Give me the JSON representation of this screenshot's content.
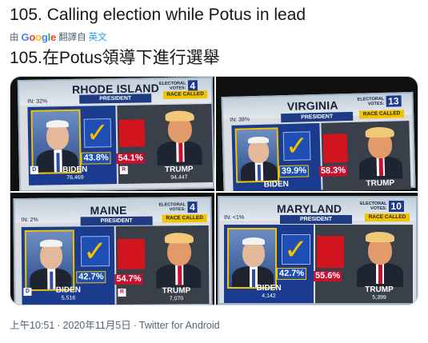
{
  "tweet": {
    "text": "105. Calling election while Potus in lead",
    "translate_prefix": "由",
    "translate_suffix": "翻譯自",
    "translate_lang": "英文",
    "translated_text": "105.在Potus領導下進行選舉",
    "meta": {
      "time": "上午10:51",
      "separator": "·",
      "date": "2020年11月5日",
      "source": "Twitter for Android"
    }
  },
  "google_logo": [
    "G",
    "o",
    "o",
    "g",
    "l",
    "e"
  ],
  "colors": {
    "dem_blue": "#1b3b8f",
    "rep_red": "#d1141d",
    "race_called_yellow": "#f4c300",
    "link_blue": "#1d9bf0"
  },
  "race_labels": {
    "electoral": "ELECTORAL",
    "votes": "VOTES:",
    "president": "PRESIDENT",
    "race_called": "RACE CALLED",
    "dem_tag": "D",
    "rep_tag": "R"
  },
  "photos": [
    {
      "state": "RHODE ISLAND",
      "electoral_votes": "4",
      "in_pct": "IN: 32%",
      "dem": {
        "name": "BIDEN",
        "pct": "43.8",
        "votes": "76,469"
      },
      "rep": {
        "name": "TRUMP",
        "pct": "54.1",
        "votes": "94,447"
      }
    },
    {
      "state": "VIRGINIA",
      "electoral_votes": "13",
      "in_pct": "IN: 38%",
      "dem": {
        "name": "BIDEN",
        "pct": "39.9",
        "votes": ""
      },
      "rep": {
        "name": "TRUMP",
        "pct": "58.3",
        "votes": ""
      }
    },
    {
      "state": "MAINE",
      "electoral_votes": "4",
      "in_pct": "IN: 2%",
      "dem": {
        "name": "BIDEN",
        "pct": "42.7",
        "votes": "5,516"
      },
      "rep": {
        "name": "TRUMP",
        "pct": "54.7",
        "votes": "7,070"
      }
    },
    {
      "state": "MARYLAND",
      "electoral_votes": "10",
      "in_pct": "IN: <1%",
      "dem": {
        "name": "BIDEN",
        "pct": "42.7",
        "votes": "4,142"
      },
      "rep": {
        "name": "TRUMP",
        "pct": "55.6",
        "votes": "5,399"
      }
    }
  ]
}
